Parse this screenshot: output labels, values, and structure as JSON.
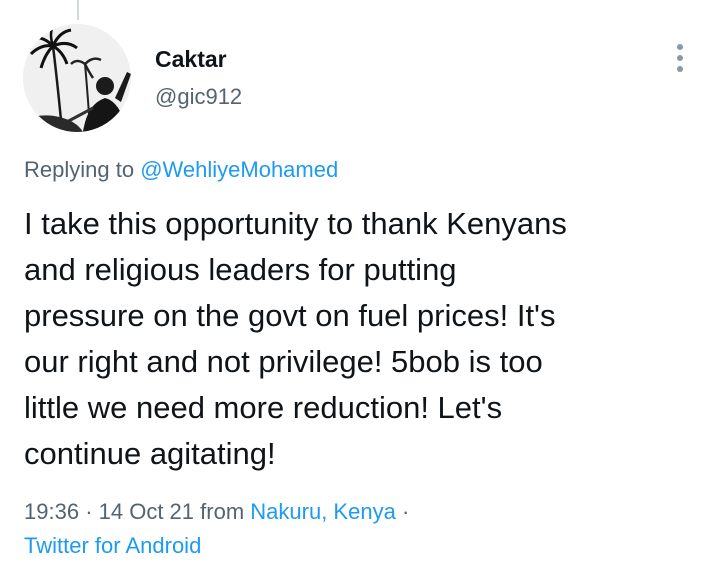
{
  "tweet": {
    "author": {
      "display_name": "Caktar",
      "handle": "@gic912",
      "avatar_icon": "avatar-photo-palm-tree"
    },
    "replying_to": {
      "prefix": "Replying to",
      "handle": "@WehliyeMohamed"
    },
    "text": "I take this opportunity to thank Kenyans\nand religious leaders for putting\npressure on the govt on fuel prices! It's\nour right and not privilege! 5bob is too\nlittle we need more reduction! Let's\ncontinue agitating!",
    "meta": {
      "time": "19:36",
      "separator": "·",
      "date": "14 Oct 21",
      "from_label": "from",
      "location": "Nakuru, Kenya",
      "trailing_separator": "·",
      "source": "Twitter for Android"
    },
    "more_icon": "more-vertical-icon"
  },
  "colors": {
    "text": "#0f1419",
    "secondary": "#536471",
    "link": "#1d9bf0",
    "thread_line": "#cfd9de"
  }
}
